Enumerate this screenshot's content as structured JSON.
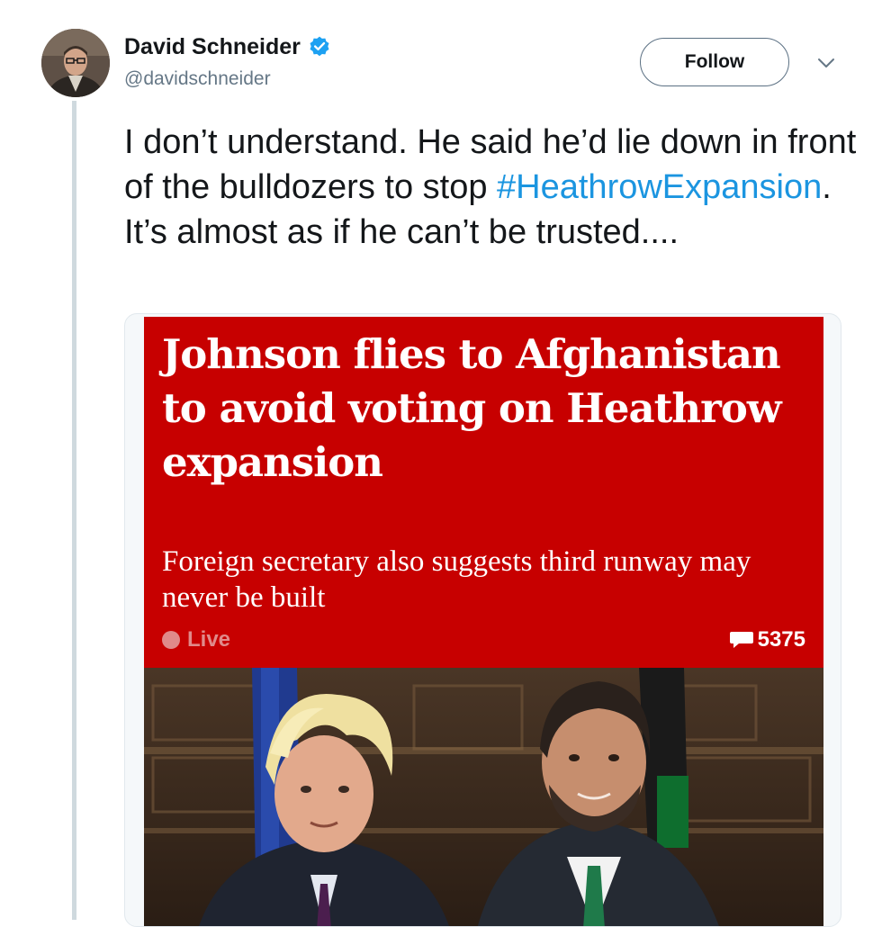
{
  "tweet": {
    "author": {
      "display_name": "David Schneider",
      "handle": "@davidschneider",
      "verified": true
    },
    "follow_label": "Follow",
    "text": {
      "before_hashtag": "I don’t understand. He said he’d lie down in front of the bulldozers to stop ",
      "hashtag": "#HeathrowExpansion",
      "after_hashtag": ". It’s almost as if he can’t be trusted...."
    },
    "media": {
      "headline": "Johnson flies to Afghanistan to avoid voting on Heathrow expansion",
      "standfirst": "Foreign secretary also suggests third runway may never be built",
      "live_label": "Live",
      "comment_count": "5375"
    }
  },
  "colors": {
    "brand_blue": "#1da1f2",
    "hashtag": "#1b95e0",
    "guardian_red": "#c70000",
    "text": "#14171a",
    "secondary_text": "#657786"
  },
  "icons": {
    "verified": "verified-badge-icon",
    "caret": "chevron-down-icon",
    "comment": "comment-bubble-icon"
  }
}
